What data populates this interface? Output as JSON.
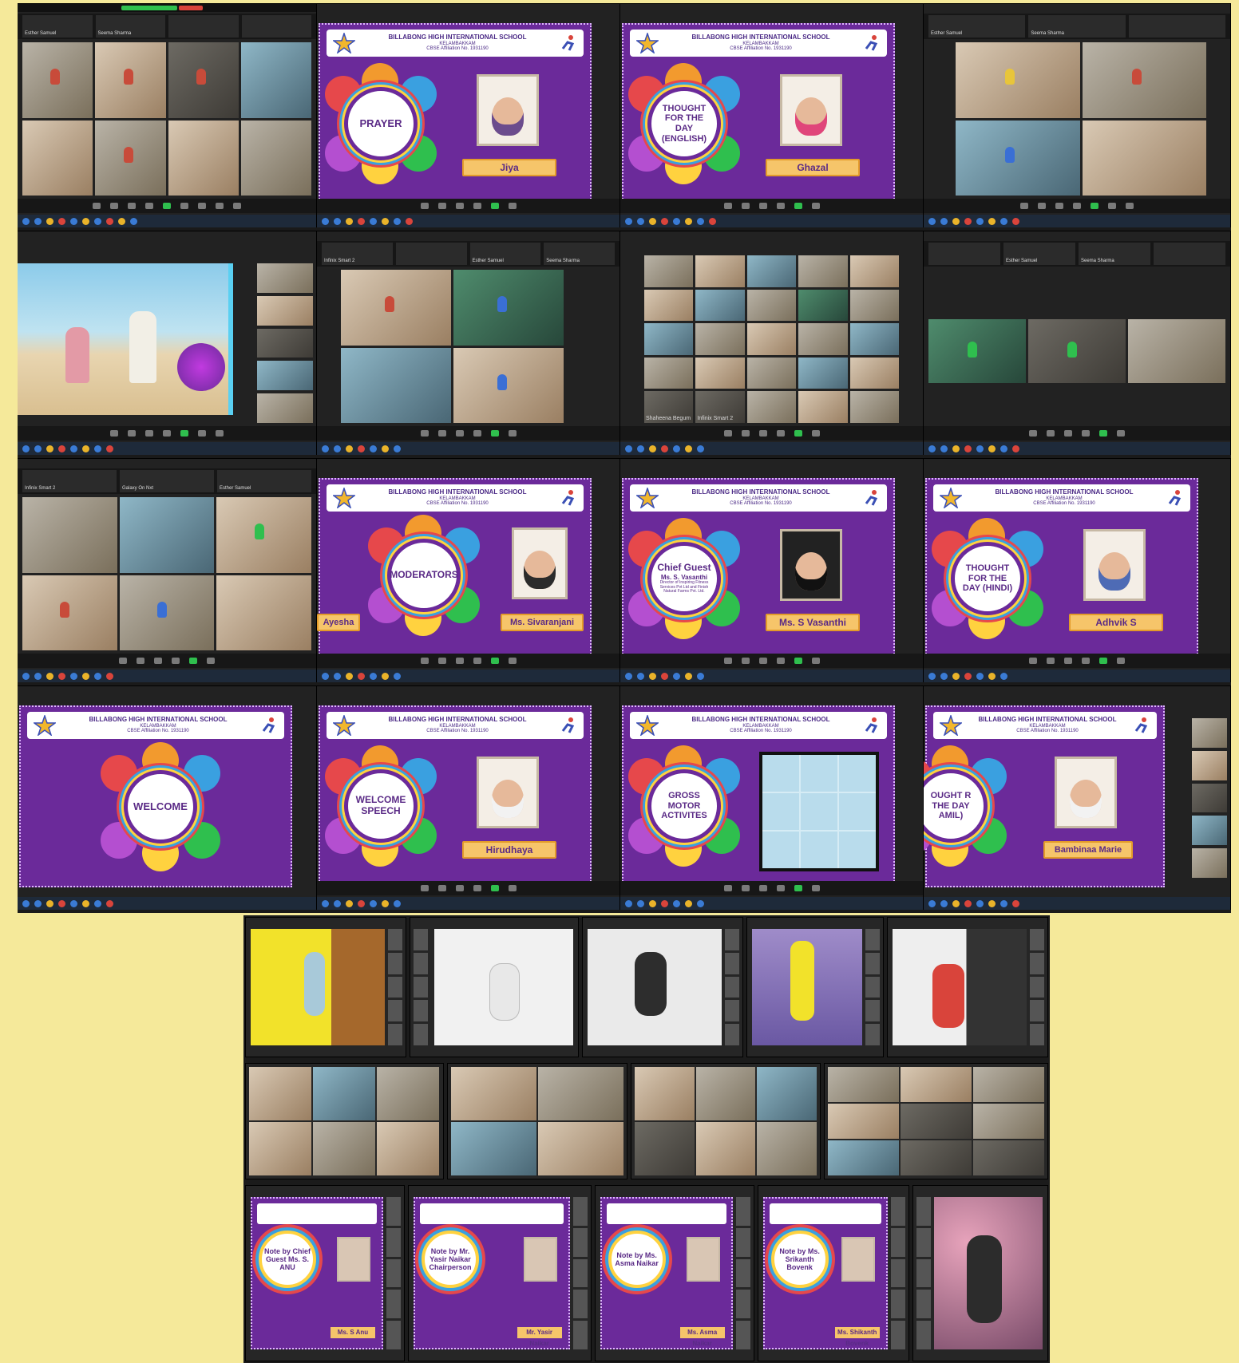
{
  "school": {
    "name": "BILLABONG HIGH INTERNATIONAL SCHOOL",
    "location": "KELAMBAKKAM",
    "affiliation": "CBSE Affiliation No. 1931190"
  },
  "participants": [
    "Esther Samuel",
    "Seema Sharma",
    "Infinix Smart 2",
    "Galaxy On Nxt",
    "Shaheena Begum"
  ],
  "slides": [
    {
      "title": "PRAYER",
      "name": "Jiya"
    },
    {
      "title": "THOUGHT FOR THE DAY (ENGLISH)",
      "name": "Ghazal"
    },
    {
      "title": "MODERATORS",
      "name": "Ms. Sivaranjani",
      "name2": "Ayesha"
    },
    {
      "title": "Chief Guest",
      "subtitle": "Ms. S. Vasanthi",
      "desc": "Director of Inspiring Fitness Services Pvt Ltd and Finish Natural Farms Pvt. Ltd.",
      "name": "Ms. S Vasanthi"
    },
    {
      "title": "THOUGHT FOR THE DAY (HINDI)",
      "name": "Adhvik S"
    },
    {
      "title": "WELCOME",
      "name": ""
    },
    {
      "title": "WELCOME SPEECH",
      "name": "Hirudhaya"
    },
    {
      "title": "GROSS MOTOR ACTIVITES",
      "name": ""
    },
    {
      "title": "OUGHT R THE DAY AMIL)",
      "name": "Bambinaa Marie"
    }
  ],
  "notes": [
    {
      "title": "Note by Chief Guest Ms. S. ANU",
      "name": "Ms. S Anu"
    },
    {
      "title": "Note by Mr. Yasir Naikar Chairperson",
      "name": "Mr. Yasir Naikar"
    },
    {
      "title": "Note by Ms. Asma Naikar",
      "name": "Ms. Asma Naikar"
    },
    {
      "title": "Note by Ms. Srikanth Bovenk",
      "name": "Ms. Shikanth Bovenk"
    }
  ],
  "toolbar": [
    "Security",
    "Participants",
    "Polls",
    "Chat",
    "Share Screen",
    "Record",
    "Breakout Rooms",
    "Reactions",
    "Apps"
  ],
  "colors": {
    "background": "#f5e99a",
    "slide_purple": "#6b2a9a",
    "namebar": "#f6c56a",
    "zoom_dark": "#1b1b1b"
  }
}
